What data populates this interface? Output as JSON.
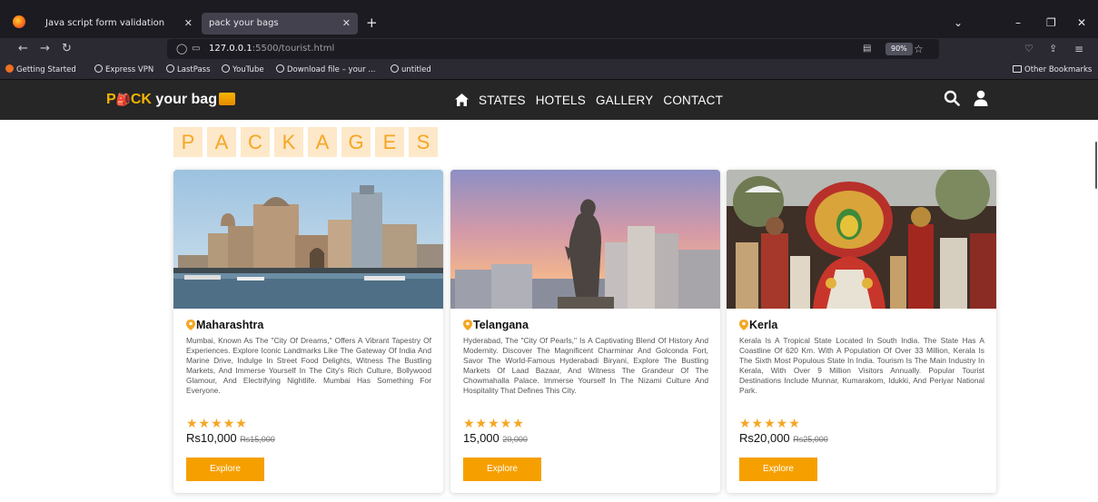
{
  "browser": {
    "tabs": [
      {
        "title": "Java script form validation",
        "active": false
      },
      {
        "title": "pack your bags",
        "active": true
      }
    ],
    "url_host": "127.0.0.1",
    "url_rest": ":5500/tourist.html",
    "zoom": "90%",
    "bookmarks": [
      "Getting Started",
      "Express VPN",
      "LastPass",
      "YouTube",
      "Download file – your ...",
      "untitled"
    ],
    "other_bookmarks": "Other Bookmarks"
  },
  "site": {
    "logo_p": "P",
    "logo_ack": "CK",
    "logo_rest": " your bag",
    "nav": [
      "STATES",
      "HOTELS",
      "GALLERY",
      "CONTACT"
    ]
  },
  "section_title_letters": [
    "P",
    "A",
    "C",
    "K",
    "A",
    "G",
    "E",
    "S"
  ],
  "cards": [
    {
      "name": "Maharashtra",
      "description": "Mumbai, Known As The \"City Of Dreams,\" Offers A Vibrant Tapestry Of Experiences. Explore Iconic Landmarks Like The Gateway Of India And Marine Drive, Indulge In Street Food Delights, Witness The Bustling Markets, And Immerse Yourself In The City's Rich Culture, Bollywood Glamour, And Electrifying Nightlife. Mumbai Has Something For Everyone.",
      "stars": "★★★★★",
      "price": "Rs10,000",
      "old_price": "Rs15,000",
      "button": "Explore"
    },
    {
      "name": "Telangana",
      "description": "Hyderabad, The \"City Of Pearls,\" Is A Captivating Blend Of History And Modernity. Discover The Magnificent Charminar And Golconda Fort, Savor The World-Famous Hyderabadi Biryani, Explore The Bustling Markets Of Laad Bazaar, And Witness The Grandeur Of The Chowmahalla Palace. Immerse Yourself In The Nizami Culture And Hospitality That Defines This City.",
      "stars": "★★★★★",
      "price": "15,000",
      "old_price": "20,000",
      "button": "Explore"
    },
    {
      "name": "Kerla",
      "description": "Kerala Is A Tropical State Located In South India. The State Has A Coastline Of 620 Km. With A Population Of Over 33 Million, Kerala Is The Sixth Most Populous State In India. Tourism Is The Main Industry In Kerala, With Over 9 Million Visitors Annually. Popular Tourist Destinations Include Munnar, Kumarakom, Idukki, And Periyar National Park.",
      "stars": "★★★★★",
      "price": "Rs20,000",
      "old_price": "Rs25,000",
      "button": "Explore"
    }
  ]
}
